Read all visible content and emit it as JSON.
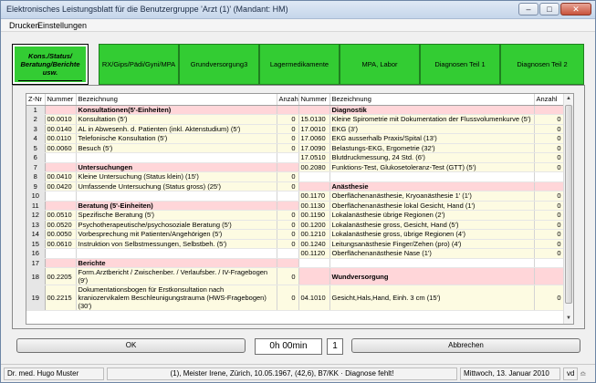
{
  "window": {
    "title": "Elektronisches Leistungsblatt für die Benutzergruppe 'Arzt (1)'  (Mandant: HM)"
  },
  "menu": [
    "Drucken",
    "Einstellungen"
  ],
  "tabs": [
    "Kons./Status/ Beratung/Berichte usw.",
    "RX/Gips/Pädi/Gyni/MPA",
    "Grundversorgung3",
    "Lagermedikamente",
    "MPA, Labor",
    "Diagnosen Teil 1",
    "Diagnosen Teil 2"
  ],
  "table": {
    "headers": {
      "zn": "Z-Nr",
      "nummer": "Nummer",
      "bezeichnung": "Bezeichnung",
      "anzahl": "Anzahl"
    },
    "rows": [
      {
        "zn": "1",
        "ln": "",
        "lb": "Konsultationen(5'-Einheiten)",
        "la": "",
        "lh": true,
        "rn": "",
        "rb": "Diagnostik",
        "ra": "",
        "rh": true
      },
      {
        "zn": "2",
        "ln": "00.0010",
        "lb": "Konsultation (5')",
        "la": "0",
        "rn": "15.0130",
        "rb": "Kleine Spirometrie mit Dokumentation der Flussvolumenkurve (5')",
        "ra": "0"
      },
      {
        "zn": "3",
        "ln": "00.0140",
        "lb": "AL in Abwesenh. d. Patienten (inkl. Aktenstudium) (5')",
        "la": "0",
        "rn": "17.0010",
        "rb": "EKG (3')",
        "ra": "0"
      },
      {
        "zn": "4",
        "ln": "00.0110",
        "lb": "Telefonische Konsultation (5')",
        "la": "0",
        "rn": "17.0060",
        "rb": "EKG ausserhalb Praxis/Spital (13')",
        "ra": "0"
      },
      {
        "zn": "5",
        "ln": "00.0060",
        "lb": "Besuch (5')",
        "la": "0",
        "rn": "17.0090",
        "rb": "Belastungs-EKG, Ergometrie (32')",
        "ra": "0"
      },
      {
        "zn": "6",
        "ln": "",
        "lb": "",
        "la": "",
        "rn": "17.0510",
        "rb": "Blutdruckmessung, 24 Std. (6')",
        "ra": "0"
      },
      {
        "zn": "7",
        "ln": "",
        "lb": "Untersuchungen",
        "la": "",
        "lh": true,
        "rn": "00.2080",
        "rb": "Funktions-Test, Glukosetoleranz-Test (GTT) (5')",
        "ra": "0"
      },
      {
        "zn": "8",
        "ln": "00.0410",
        "lb": "Kleine Untersuchung (Status klein) (15')",
        "la": "0",
        "rn": "",
        "rb": "",
        "ra": ""
      },
      {
        "zn": "9",
        "ln": "00.0420",
        "lb": "Umfassende Untersuchung (Status gross) (25')",
        "la": "0",
        "rn": "",
        "rb": "Anästhesie",
        "ra": "",
        "rh": true
      },
      {
        "zn": "10",
        "ln": "",
        "lb": "",
        "la": "",
        "rn": "00.1170",
        "rb": "Oberflächenanästhesie, Kryoanästhesie  1' (1')",
        "ra": "0"
      },
      {
        "zn": "11",
        "ln": "",
        "lb": "Beratung    (5'-Einheiten)",
        "la": "",
        "lh": true,
        "rn": "00.1130",
        "rb": "Oberflächenanästhesie lokal Gesicht, Hand (1')",
        "ra": "0"
      },
      {
        "zn": "12",
        "ln": "00.0510",
        "lb": "Spezifische Beratung (5')",
        "la": "0",
        "rn": "00.1190",
        "rb": "Lokalanästhesie übrige Regionen (2')",
        "ra": "0"
      },
      {
        "zn": "13",
        "ln": "00.0520",
        "lb": "Psychotherapeutische/psychosoziale Beratung (5')",
        "la": "0",
        "rn": "00.1200",
        "rb": "Lokalanästhesie gross, Gesicht, Hand (5')",
        "ra": "0"
      },
      {
        "zn": "14",
        "ln": "00.0050",
        "lb": "Vorbesprechung mit Patienten/Angehörigen (5')",
        "la": "0",
        "rn": "00.1210",
        "rb": "Lokalanästhesie gross, übrige Regionen (4')",
        "ra": "0"
      },
      {
        "zn": "15",
        "ln": "00.0610",
        "lb": "Instruktion von Selbstmessungen, Selbstbeh. (5')",
        "la": "0",
        "rn": "00.1240",
        "rb": "Leitungsanästhesie Finger/Zehen (pro) (4')",
        "ra": "0"
      },
      {
        "zn": "16",
        "ln": "",
        "lb": "",
        "la": "",
        "rn": "00.1120",
        "rb": "Oberflächenanästhesie Nase (1')",
        "ra": "0"
      },
      {
        "zn": "17",
        "ln": "",
        "lb": "Berichte",
        "la": "",
        "lh": true,
        "rn": "",
        "rb": "",
        "ra": ""
      },
      {
        "zn": "18",
        "ln": "00.2205",
        "lb": "Form.Arztbericht / Zwischenber. / Verlaufsber. / IV-Fragebogen (9')",
        "la": "0",
        "rn": "",
        "rb": "Wundversorgung",
        "ra": "",
        "rh": true,
        "tall": true
      },
      {
        "zn": "19",
        "ln": "00.2215",
        "lb": "Dokumentationsbogen für Erstkonsultation nach kraniozervikalem Beschleunigungstrauma (HWS-Fragebogen) (30')",
        "la": "0",
        "rn": "04.1010",
        "rb": "Gesicht,Hals,Hand, Einh. 3 cm (15')",
        "ra": "0",
        "taller": true
      }
    ]
  },
  "bottom": {
    "ok": "OK",
    "time": "0h 00min",
    "count": "1",
    "cancel": "Abbrechen"
  },
  "status": {
    "doctor": "Dr. med. Hugo Muster",
    "patient": "(1), Meister Irene, Zürich, 10.05.1967, (42,6), B7/KK · Diagnose fehlt!",
    "date": "Mittwoch, 13. Januar 2010",
    "user": "vd"
  }
}
